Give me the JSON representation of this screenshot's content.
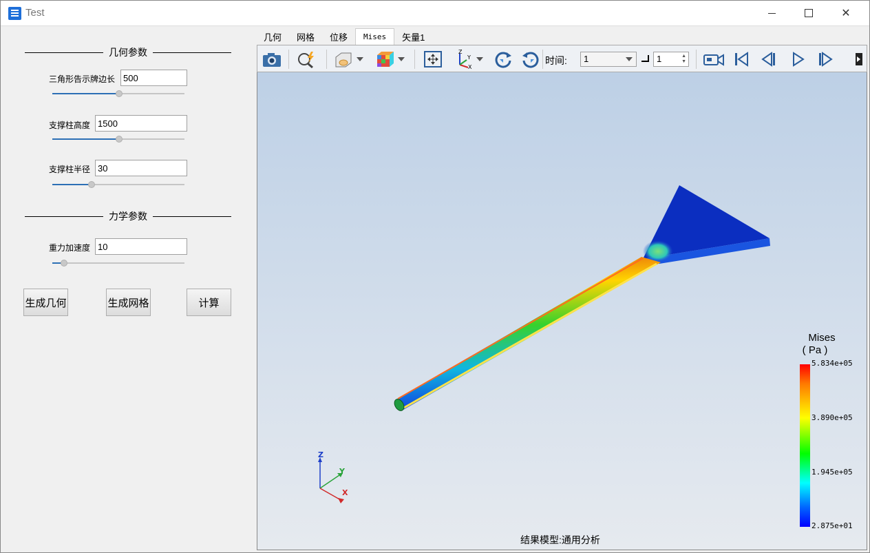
{
  "window": {
    "title": "Test"
  },
  "left": {
    "geometry_section": "几何参数",
    "mechanics_section": "力学参数",
    "params": [
      {
        "label": "三角形告示牌边长",
        "value": "500",
        "slider": 0.5
      },
      {
        "label": "支撑柱高度",
        "value": "1500",
        "slider": 0.5
      },
      {
        "label": "支撑柱半径",
        "value": "30",
        "slider": 0.3
      },
      {
        "label": "重力加速度",
        "value": "10",
        "slider": 0.09
      }
    ],
    "buttons": {
      "gen_geometry": "生成几何",
      "gen_mesh": "生成网格",
      "compute": "计算"
    }
  },
  "tabs": [
    "几何",
    "网格",
    "位移",
    "Mises",
    "矢量1"
  ],
  "active_tab": "Mises",
  "toolbar": {
    "time_label": "时间:",
    "time_value": "1",
    "step_value": "1",
    "icons": [
      "camera-icon",
      "zoom-fit-icon",
      "display-style-icon",
      "color-cube-icon",
      "fit-view-icon",
      "axes-view-icon",
      "rotate-cw-icon",
      "rotate-ccw-icon",
      "record-video-icon",
      "first-frame-icon",
      "prev-frame-icon",
      "play-icon",
      "next-frame-icon",
      "more-icon"
    ]
  },
  "legend": {
    "title": "Mises",
    "unit": "( Pa )",
    "ticks": [
      "5.834e+05",
      "3.890e+05",
      "1.945e+05",
      "2.875e+01"
    ],
    "colors": [
      "#ff0000",
      "#ffff00",
      "#00ff00",
      "#00ffff",
      "#0000ff"
    ]
  },
  "axes": {
    "x": "X",
    "y": "Y",
    "z": "Z"
  },
  "status": "结果模型:通用分析"
}
